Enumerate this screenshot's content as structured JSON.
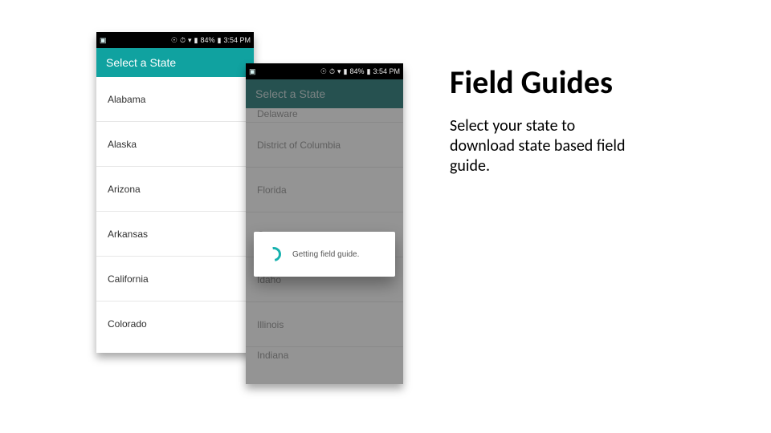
{
  "slide": {
    "title": "Field Guides",
    "body": "Select your state to download state based field guide."
  },
  "status": {
    "battery_pct": "84%",
    "time": "3:54 PM",
    "wifi_glyph": "▾",
    "alarm_glyph": "⏱",
    "vibrate_glyph": "☉",
    "app_glyph": "▣",
    "signal_glyph": "▮",
    "battery_glyph": "▮"
  },
  "phone1": {
    "title": "Select a State",
    "rows": [
      "Alabama",
      "Alaska",
      "Arizona",
      "Arkansas",
      "California",
      "Colorado"
    ]
  },
  "phone2": {
    "title": "Select a State",
    "rows_top": "Delaware",
    "rows": [
      "District of Columbia",
      "Florida",
      "G",
      "Idaho",
      "Illinois"
    ],
    "rows_bottom": "Indiana",
    "dialog": "Getting field guide."
  }
}
